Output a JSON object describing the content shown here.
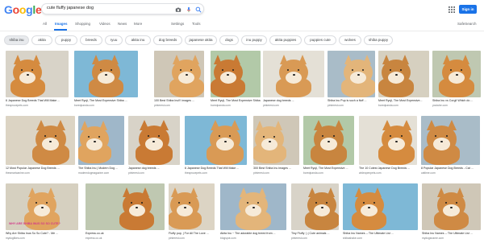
{
  "logo": {
    "letters": [
      "G",
      "o",
      "o",
      "g",
      "l",
      "e"
    ],
    "colors": [
      "#4285F4",
      "#EA4335",
      "#FBBC05",
      "#4285F4",
      "#34A853",
      "#EA4335"
    ]
  },
  "search": {
    "query": "cute fluffy japanese dog"
  },
  "header": {
    "sign_in": "Sign in"
  },
  "tabs": [
    {
      "label": "All"
    },
    {
      "label": "Images"
    },
    {
      "label": "Shopping"
    },
    {
      "label": "Videos"
    },
    {
      "label": "News"
    },
    {
      "label": "More"
    },
    {
      "label": "Settings"
    },
    {
      "label": "Tools"
    }
  ],
  "safesearch": "SafeSearch",
  "chips": [
    "shiba inu",
    "akita",
    "puppy",
    "breeds",
    "ryuu",
    "akita inu",
    "dog breeds",
    "japanese akita",
    "dogs",
    "inu puppy",
    "akita puppies",
    "puppies cute",
    "wolves",
    "shiba puppy"
  ],
  "rows": [
    [
      {
        "caption": "6 Japanese Dog Breeds That Will Make ...",
        "source": "thesprucepets.com"
      },
      {
        "caption": "Meet Ryuji, The Most Expensive Shiba ...",
        "source": "boredpanda.com"
      },
      {
        "caption": "100 Best Shiba Inu!!! images ...",
        "source": "pinterest.com"
      },
      {
        "caption": "Meet Ryuji, The Most Expensive Shiba ...",
        "source": "boredpanda.com"
      },
      {
        "caption": "Japanese dog breeds ...",
        "source": "pinterest.com"
      },
      {
        "caption": "Shiba Inu Pup is such a fluff ...",
        "source": "pinterest.com"
      },
      {
        "caption": "Meet Ryuji, The Most Expensive...",
        "source": "boredpanda.com"
      },
      {
        "caption": "Shiba Inu vs Corgi! Which do ...",
        "source": "youtube.com"
      }
    ],
    [
      {
        "caption": "12 Most Popular Japanese Dog Breeds ...",
        "source": "thesmartcanine.com"
      },
      {
        "caption": "The Shiba Inu | Modern Dog ...",
        "source": "moderndogmagazine.com"
      },
      {
        "caption": "Japanese dog breeds ...",
        "source": "pinterest.com"
      },
      {
        "caption": "6 Japanese Dog Breeds That Will Make ...",
        "source": "thesprucepets.com"
      },
      {
        "caption": "300 Best Shiba Inu images ...",
        "source": "pinterest.com"
      },
      {
        "caption": "Meet Ryuji, The Most Expensive ...",
        "source": "boredpanda.com"
      },
      {
        "caption": "The 10 Cutest Japanese Dog Breeds ...",
        "source": "wideopenpets.com"
      },
      {
        "caption": "8 Popular Japanese Dog Breeds - Cat ...",
        "source": "cattime.com"
      }
    ],
    [
      {
        "caption": "Why Are Shiba Inus So So Cute? - Me ...",
        "source": "mydoglikes.com"
      },
      {
        "caption": "Express.co.uk",
        "source": "express.co.uk"
      },
      {
        "caption": "Fluffy pup, | For All The Love ...",
        "source": "pinterest.com"
      },
      {
        "caption": "Akita Inu ~ The adorable dog breed from ...",
        "source": "blogspot.com"
      },
      {
        "caption": "Tiny Fluffy :) | Cute animals ...",
        "source": "pinterest.com"
      },
      {
        "caption": "Shiba Inu Names -- The Ultimate List ...",
        "source": "shibashake.com"
      },
      {
        "caption": "Shiba Inu Names -- The Ultimate List ...",
        "source": "mydogsname.com"
      }
    ]
  ],
  "banner": {
    "text": "WHY ARE SHIBA INUS SO SO CUTE?"
  }
}
